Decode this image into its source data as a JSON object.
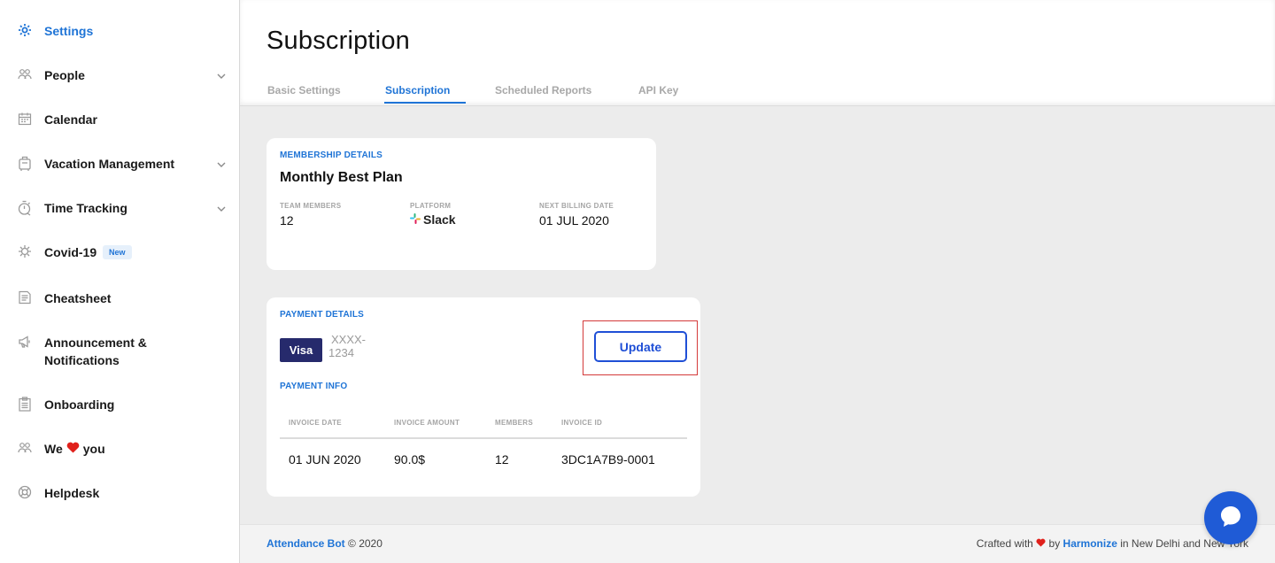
{
  "sidebar": {
    "items": [
      {
        "label": "Settings",
        "icon": "gear-icon",
        "active": true
      },
      {
        "label": "People",
        "icon": "people-icon",
        "chevron": true
      },
      {
        "label": "Calendar",
        "icon": "calendar-icon"
      },
      {
        "label": "Vacation Management",
        "icon": "luggage-icon",
        "chevron": true
      },
      {
        "label": "Time Tracking",
        "icon": "stopwatch-icon",
        "chevron": true
      },
      {
        "label": "Covid-19",
        "icon": "virus-icon",
        "badge": "New"
      },
      {
        "label": "Cheatsheet",
        "icon": "document-icon"
      },
      {
        "label_line1": "Announcement &",
        "label_line2": "Notifications",
        "icon": "megaphone-icon"
      },
      {
        "label": "Onboarding",
        "icon": "clipboard-icon"
      },
      {
        "label_pre": "We",
        "label_post": "you",
        "icon": "people-icon"
      },
      {
        "label": "Helpdesk",
        "icon": "lifebuoy-icon"
      }
    ]
  },
  "header": {
    "title": "Subscription",
    "tabs": [
      {
        "label": "Basic Settings"
      },
      {
        "label": "Subscription",
        "active": true
      },
      {
        "label": "Scheduled Reports"
      },
      {
        "label": "API Key"
      }
    ]
  },
  "membership": {
    "section_title": "MEMBERSHIP DETAILS",
    "plan": "Monthly Best Plan",
    "team_members_label": "TEAM MEMBERS",
    "team_members": "12",
    "platform_label": "PLATFORM",
    "platform": "Slack",
    "next_billing_label": "NEXT BILLING DATE",
    "next_billing": "01 JUL 2020"
  },
  "payment": {
    "section_title": "PAYMENT DETAILS",
    "card_brand": "Visa",
    "masked_line1": "XXXX-",
    "masked_line2": "1234",
    "update_label": "Update",
    "info_title": "PAYMENT INFO",
    "columns": [
      "INVOICE DATE",
      "INVOICE AMOUNT",
      "MEMBERS",
      "INVOICE ID"
    ],
    "rows": [
      [
        "01 JUN 2020",
        "90.0$",
        "12",
        "3DC1A7B9-0001"
      ]
    ]
  },
  "footer": {
    "brand": "Attendance Bot",
    "copyright": "© 2020",
    "crafted_pre": "Crafted with",
    "crafted_by": "by",
    "company": "Harmonize",
    "location": "in New Delhi and New York"
  },
  "colors": {
    "accent": "#1f74d6",
    "button": "#1f4fd6",
    "visa": "#262a6c",
    "heart": "#e0201b"
  }
}
